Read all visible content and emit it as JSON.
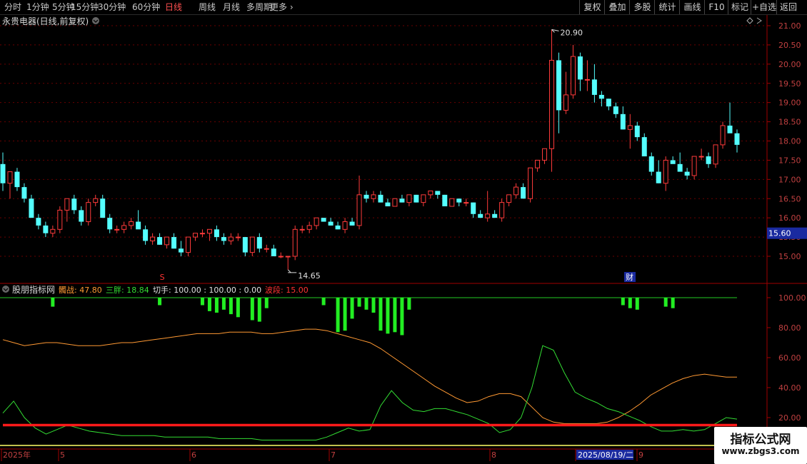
{
  "toolbar": {
    "periods": [
      "分时",
      "1分钟",
      "5分钟",
      "15分钟",
      "30分钟",
      "60分钟",
      "日线",
      "周线",
      "月线",
      "多周期",
      "更多"
    ],
    "active_period": "日线",
    "right_buttons": [
      "复权",
      "叠加",
      "多股",
      "统计",
      "画线",
      "F10",
      "标记",
      "+自选",
      "返回"
    ]
  },
  "main_chart": {
    "title": "永贵电器(日线,前复权)",
    "price_axis": [
      "21.00",
      "20.50",
      "20.00",
      "19.50",
      "19.00",
      "18.50",
      "18.00",
      "17.50",
      "17.00",
      "16.50",
      "16.00",
      "15.50",
      "15.00"
    ],
    "current_price_tag": "15.60",
    "high_label": "20.90",
    "low_label": "14.65",
    "marker_s": "S",
    "marker_cai": "财"
  },
  "indicator": {
    "name": "股朋指标网",
    "items": [
      {
        "label": "髑战: 47.80",
        "color": "#ff9933"
      },
      {
        "label": "三胖: 18.84",
        "color": "#33dd33"
      },
      {
        "label": "切手: 100.00 : 100.00 : 0.00",
        "color": "#e0e0e0"
      },
      {
        "label": "波段: 15.00",
        "color": "#ff3333"
      }
    ],
    "axis": [
      "100.00",
      "80.00",
      "60.00",
      "40.00",
      "20.00"
    ]
  },
  "date_axis": [
    {
      "label": "2025年",
      "highlight": false
    },
    {
      "label": "5",
      "highlight": false
    },
    {
      "label": "6",
      "highlight": false
    },
    {
      "label": "7",
      "highlight": false
    },
    {
      "label": "8",
      "highlight": false
    },
    {
      "label": "2025/08/19/二",
      "highlight": true
    },
    {
      "label": "9",
      "highlight": false
    }
  ],
  "chart_data": [
    {
      "type": "candlestick",
      "title": "永贵电器(日线,前复权)",
      "ylim": [
        14.5,
        21.2
      ],
      "ohlc": [
        [
          17.4,
          17.7,
          16.7,
          16.9
        ],
        [
          16.9,
          17.1,
          16.5,
          17.2
        ],
        [
          17.2,
          17.3,
          16.7,
          16.8
        ],
        [
          16.8,
          16.9,
          16.4,
          16.5
        ],
        [
          16.5,
          16.6,
          16.1,
          16.0
        ],
        [
          16.0,
          16.1,
          15.7,
          15.8
        ],
        [
          15.8,
          15.9,
          15.5,
          15.6
        ],
        [
          15.6,
          15.8,
          15.5,
          15.7
        ],
        [
          15.7,
          16.3,
          15.6,
          16.2
        ],
        [
          16.2,
          16.5,
          15.9,
          16.5
        ],
        [
          16.5,
          16.6,
          16.1,
          16.2
        ],
        [
          16.2,
          16.3,
          15.8,
          15.9
        ],
        [
          15.9,
          16.5,
          15.8,
          16.4
        ],
        [
          16.4,
          16.6,
          16.3,
          16.5
        ],
        [
          16.5,
          16.6,
          16.0,
          16.0
        ],
        [
          16.0,
          16.1,
          15.6,
          15.7
        ],
        [
          15.7,
          15.8,
          15.6,
          15.7
        ],
        [
          15.7,
          15.9,
          15.6,
          15.8
        ],
        [
          15.8,
          16.0,
          15.7,
          15.9
        ],
        [
          15.9,
          16.2,
          15.8,
          15.7
        ],
        [
          15.7,
          15.8,
          15.3,
          15.4
        ],
        [
          15.4,
          15.6,
          15.3,
          15.5
        ],
        [
          15.5,
          15.6,
          15.3,
          15.3
        ],
        [
          15.3,
          15.5,
          15.2,
          15.5
        ],
        [
          15.5,
          15.6,
          15.2,
          15.2
        ],
        [
          15.2,
          15.4,
          15.0,
          15.1
        ],
        [
          15.1,
          15.5,
          15.0,
          15.5
        ],
        [
          15.5,
          15.6,
          15.4,
          15.6
        ],
        [
          15.6,
          15.7,
          15.5,
          15.6
        ],
        [
          15.6,
          15.7,
          15.4,
          15.7
        ],
        [
          15.7,
          15.8,
          15.4,
          15.5
        ],
        [
          15.5,
          15.6,
          15.3,
          15.4
        ],
        [
          15.4,
          15.6,
          15.3,
          15.5
        ],
        [
          15.5,
          15.6,
          15.4,
          15.5
        ],
        [
          15.5,
          15.5,
          15.0,
          15.1
        ],
        [
          15.1,
          15.5,
          15.0,
          15.5
        ],
        [
          15.5,
          15.6,
          15.1,
          15.2
        ],
        [
          15.2,
          15.3,
          15.1,
          15.2
        ],
        [
          15.2,
          15.3,
          15.0,
          15.0
        ],
        [
          15.0,
          15.1,
          14.95,
          15.0
        ],
        [
          15.0,
          15.0,
          14.65,
          15.0
        ],
        [
          15.0,
          15.8,
          14.9,
          15.7
        ],
        [
          15.7,
          15.8,
          15.6,
          15.7
        ],
        [
          15.7,
          15.9,
          15.6,
          15.8
        ],
        [
          15.8,
          16.0,
          15.7,
          16.0
        ],
        [
          16.0,
          16.0,
          15.9,
          15.9
        ],
        [
          15.9,
          16.0,
          15.8,
          15.8
        ],
        [
          15.8,
          15.9,
          15.7,
          15.7
        ],
        [
          15.7,
          16.0,
          15.6,
          15.9
        ],
        [
          15.9,
          16.0,
          15.8,
          15.8
        ],
        [
          15.8,
          17.1,
          15.7,
          16.6
        ],
        [
          16.6,
          16.7,
          16.4,
          16.5
        ],
        [
          16.5,
          16.7,
          16.4,
          16.6
        ],
        [
          16.6,
          16.7,
          16.4,
          16.4
        ],
        [
          16.4,
          16.5,
          16.3,
          16.3
        ],
        [
          16.3,
          16.5,
          16.3,
          16.5
        ],
        [
          16.5,
          16.6,
          16.4,
          16.4
        ],
        [
          16.4,
          16.5,
          16.3,
          16.6
        ],
        [
          16.6,
          16.6,
          16.4,
          16.4
        ],
        [
          16.4,
          16.6,
          16.3,
          16.6
        ],
        [
          16.6,
          16.7,
          16.5,
          16.7
        ],
        [
          16.7,
          16.7,
          16.5,
          16.6
        ],
        [
          16.6,
          16.6,
          16.3,
          16.3
        ],
        [
          16.3,
          16.5,
          16.3,
          16.5
        ],
        [
          16.5,
          16.5,
          16.3,
          16.4
        ],
        [
          16.4,
          16.5,
          16.3,
          16.4
        ],
        [
          16.4,
          16.4,
          16.0,
          16.1
        ],
        [
          16.1,
          16.2,
          16.0,
          16.0
        ],
        [
          16.0,
          16.7,
          15.9,
          16.1
        ],
        [
          16.1,
          16.2,
          16.0,
          16.0
        ],
        [
          16.0,
          16.5,
          15.9,
          16.4
        ],
        [
          16.4,
          16.6,
          16.3,
          16.6
        ],
        [
          16.6,
          16.9,
          16.5,
          16.8
        ],
        [
          16.8,
          16.9,
          16.7,
          16.5
        ],
        [
          16.5,
          17.3,
          16.4,
          17.3
        ],
        [
          17.3,
          17.5,
          17.2,
          17.5
        ],
        [
          17.5,
          17.8,
          17.4,
          17.8
        ],
        [
          17.8,
          20.9,
          17.2,
          20.1
        ],
        [
          20.1,
          20.3,
          18.2,
          18.8
        ],
        [
          18.8,
          19.8,
          18.7,
          19.2
        ],
        [
          19.2,
          20.5,
          19.1,
          20.2
        ],
        [
          20.2,
          20.3,
          19.3,
          19.6
        ],
        [
          19.6,
          20.1,
          19.3,
          19.6
        ],
        [
          19.6,
          20.0,
          19.0,
          19.2
        ],
        [
          19.2,
          19.3,
          18.9,
          19.1
        ],
        [
          19.1,
          19.1,
          18.8,
          18.9
        ],
        [
          18.9,
          19.0,
          18.6,
          18.7
        ],
        [
          18.7,
          18.9,
          18.3,
          18.3
        ],
        [
          18.3,
          18.7,
          17.8,
          18.4
        ],
        [
          18.4,
          18.5,
          18.0,
          18.1
        ],
        [
          18.1,
          18.2,
          17.6,
          17.6
        ],
        [
          17.6,
          17.7,
          17.1,
          17.2
        ],
        [
          17.2,
          17.5,
          16.9,
          16.9
        ],
        [
          16.9,
          17.6,
          16.7,
          17.5
        ],
        [
          17.5,
          17.6,
          17.5,
          17.4
        ],
        [
          17.4,
          17.7,
          17.2,
          17.2
        ],
        [
          17.2,
          17.3,
          17.0,
          17.1
        ],
        [
          17.1,
          17.6,
          17.0,
          17.6
        ],
        [
          17.6,
          17.8,
          17.5,
          17.6
        ],
        [
          17.6,
          17.7,
          17.3,
          17.4
        ],
        [
          17.4,
          17.9,
          17.3,
          17.9
        ],
        [
          17.9,
          18.5,
          17.8,
          18.4
        ],
        [
          18.4,
          19.0,
          18.3,
          18.2
        ],
        [
          18.2,
          18.3,
          17.7,
          17.9
        ]
      ]
    },
    {
      "type": "indicator",
      "ylim": [
        0,
        110
      ],
      "lines": [
        {
          "name": "髑战",
          "color": "#ff9933",
          "values": [
            72,
            70,
            68,
            69,
            70,
            70,
            69,
            68,
            68,
            68,
            69,
            70,
            70,
            71,
            72,
            73,
            74,
            75,
            76,
            76,
            76,
            77,
            77,
            77,
            76,
            76,
            77,
            78,
            79,
            79,
            78,
            76,
            74,
            72,
            70,
            66,
            61,
            56,
            51,
            46,
            41,
            37,
            33,
            30,
            31,
            34,
            36,
            36,
            34,
            27,
            20,
            17,
            16,
            16,
            16,
            16,
            17,
            20,
            24,
            29,
            35,
            39,
            43,
            46,
            48,
            49,
            48,
            47,
            47
          ]
        },
        {
          "name": "三胖",
          "color": "#33dd33",
          "values": [
            23,
            31,
            20,
            13,
            9,
            12,
            15,
            13,
            11,
            10,
            9,
            8,
            8,
            8,
            8,
            7,
            7,
            7,
            7,
            7,
            6,
            6,
            6,
            6,
            5,
            5,
            5,
            5,
            5,
            5,
            7,
            10,
            13,
            11,
            12,
            28,
            38,
            30,
            25,
            24,
            26,
            26,
            24,
            22,
            19,
            16,
            10,
            12,
            20,
            40,
            68,
            65,
            50,
            37,
            33,
            30,
            26,
            24,
            21,
            18,
            14,
            11,
            11,
            12,
            11,
            12,
            16,
            20,
            19
          ]
        },
        {
          "name": "波段",
          "color": "#ff2222",
          "values": [
            15,
            15,
            15
          ]
        }
      ],
      "bars_note": "green bars hanging from 100 downward",
      "bars": [
        {
          "i": 7,
          "v": 94
        },
        {
          "i": 22,
          "v": 95
        },
        {
          "i": 28,
          "v": 95
        },
        {
          "i": 29,
          "v": 91
        },
        {
          "i": 30,
          "v": 90
        },
        {
          "i": 31,
          "v": 92
        },
        {
          "i": 32,
          "v": 89
        },
        {
          "i": 33,
          "v": 87
        },
        {
          "i": 35,
          "v": 85
        },
        {
          "i": 36,
          "v": 84
        },
        {
          "i": 37,
          "v": 93
        },
        {
          "i": 45,
          "v": 95
        },
        {
          "i": 47,
          "v": 77
        },
        {
          "i": 48,
          "v": 78
        },
        {
          "i": 49,
          "v": 86
        },
        {
          "i": 50,
          "v": 94
        },
        {
          "i": 51,
          "v": 92
        },
        {
          "i": 52,
          "v": 90
        },
        {
          "i": 53,
          "v": 78
        },
        {
          "i": 54,
          "v": 76
        },
        {
          "i": 55,
          "v": 77
        },
        {
          "i": 56,
          "v": 75
        },
        {
          "i": 57,
          "v": 92
        },
        {
          "i": 87,
          "v": 95
        },
        {
          "i": 88,
          "v": 93
        },
        {
          "i": 89,
          "v": 92
        },
        {
          "i": 93,
          "v": 94
        },
        {
          "i": 94,
          "v": 93
        }
      ]
    }
  ]
}
